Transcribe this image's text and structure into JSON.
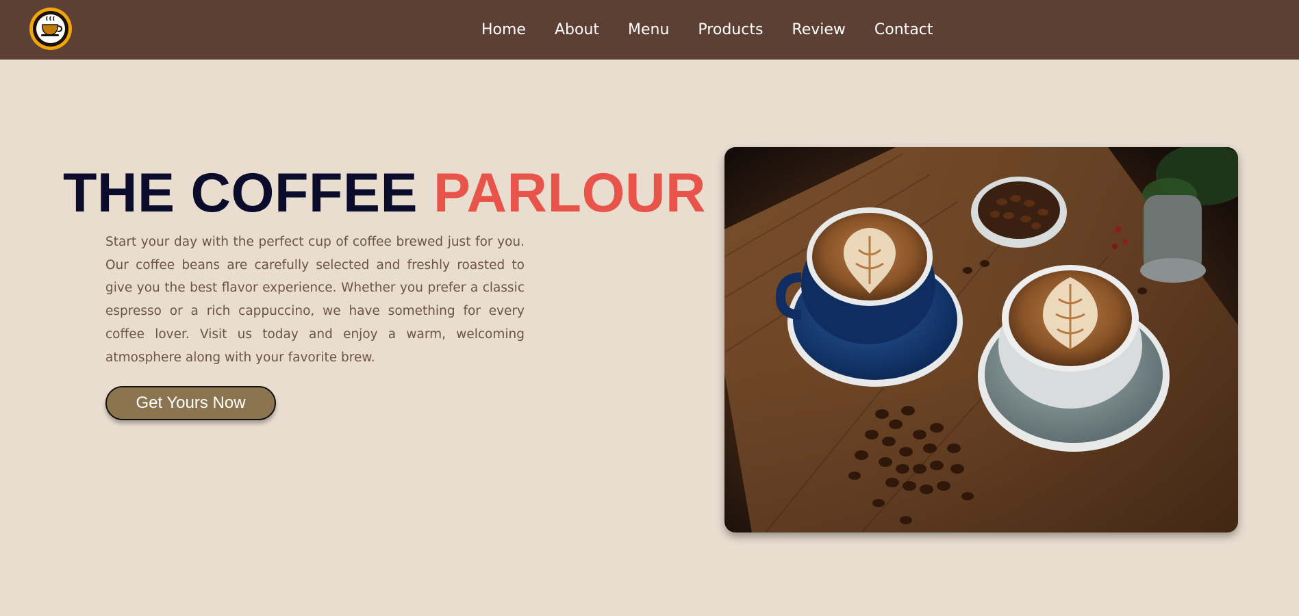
{
  "logo": {
    "icon": "coffee-cup-logo",
    "ring_text": "CAFE & BRUNCH · COFFEE HOUSE",
    "colors": {
      "ring": "#f2a60c",
      "cup": "#c17d0a",
      "face": "#ffffff"
    }
  },
  "nav": {
    "items": [
      {
        "label": "Home"
      },
      {
        "label": "About"
      },
      {
        "label": "Menu"
      },
      {
        "label": "Products"
      },
      {
        "label": "Review"
      },
      {
        "label": "Contact"
      }
    ]
  },
  "hero": {
    "title_part1": "THE COFFEE",
    "title_part2": "PARLOUR",
    "description": "Start your day with the perfect cup of coffee brewed just for you. Our coffee beans are carefully selected and freshly roasted to give you the best flavor experience. Whether you prefer a classic espresso or a rich cappuccino, we have something for every coffee lover. Visit us today and enjoy a warm, welcoming atmosphere along with your favorite brew.",
    "cta_label": "Get Yours Now",
    "image": "coffee-cups-photo"
  },
  "colors": {
    "page_bg": "#e9ddd0",
    "navbar_bg": "#5c4033",
    "title_dark": "#0b0b2b",
    "title_accent": "#e8544a",
    "body_text": "#6b5440",
    "button_bg": "#8b7551"
  }
}
